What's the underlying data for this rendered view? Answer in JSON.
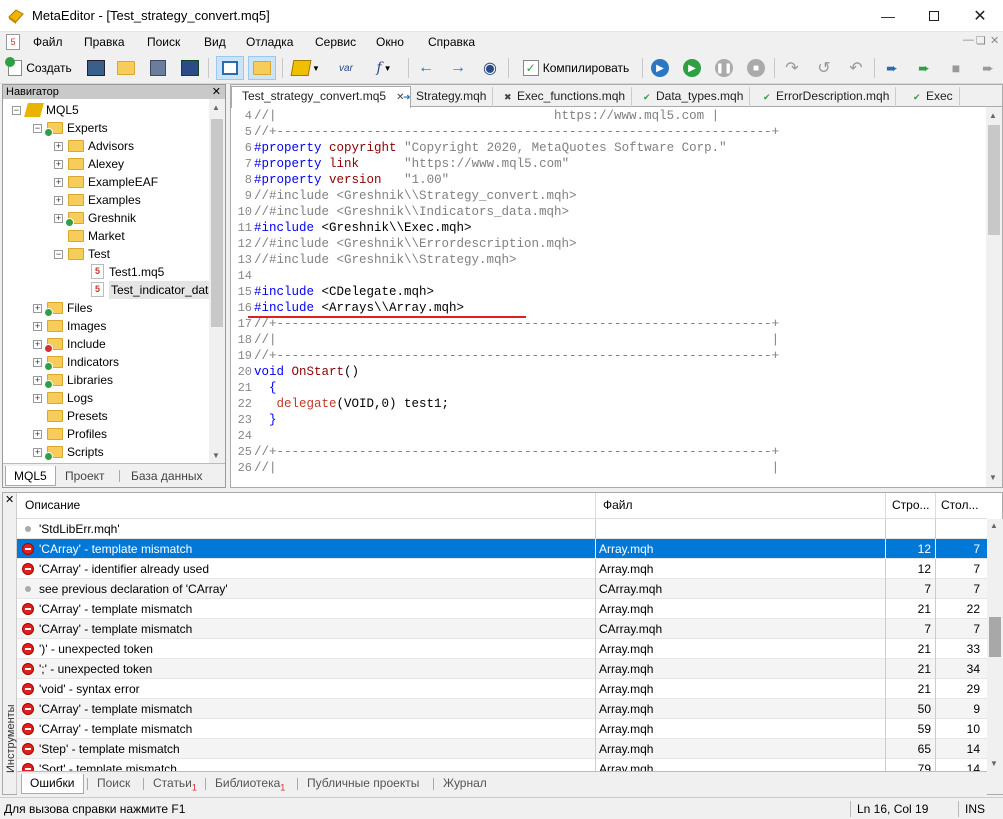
{
  "window": {
    "title": "MetaEditor - [Test_strategy_convert.mq5]"
  },
  "menu": [
    "Файл",
    "Правка",
    "Поиск",
    "Вид",
    "Отладка",
    "Сервис",
    "Окно",
    "Справка"
  ],
  "toolbar": {
    "create_label": "Создать",
    "compile_label": "Компилировать",
    "var_label": "var"
  },
  "navigator": {
    "title": "Навигатор",
    "items": [
      {
        "label": "MQL5"
      },
      {
        "label": "Experts"
      },
      {
        "label": "Advisors"
      },
      {
        "label": "Alexey"
      },
      {
        "label": "ExampleEAF"
      },
      {
        "label": "Examples"
      },
      {
        "label": "Greshnik"
      },
      {
        "label": "Market"
      },
      {
        "label": "Test"
      },
      {
        "label": "Test1.mq5"
      },
      {
        "label": "Test_indicator_data.m"
      },
      {
        "label": "Files"
      },
      {
        "label": "Images"
      },
      {
        "label": "Include"
      },
      {
        "label": "Indicators"
      },
      {
        "label": "Libraries"
      },
      {
        "label": "Logs"
      },
      {
        "label": "Presets"
      },
      {
        "label": "Profiles"
      },
      {
        "label": "Scripts"
      }
    ],
    "tabs": [
      "MQL5",
      "Проект",
      "База данных"
    ]
  },
  "editor": {
    "tabs": [
      "Test_strategy_convert.mq5",
      "Strategy.mqh",
      "Exec_functions.mqh",
      "Data_types.mqh",
      "ErrorDescription.mqh",
      "Exec"
    ],
    "lines": [
      {
        "n": "4",
        "t": "//|                                     https://www.mql5.com |",
        "c": "cm"
      },
      {
        "n": "5",
        "t": "//+------------------------------------------------------------------+",
        "c": "cm"
      },
      {
        "n": "6",
        "t": "#property copyright \"Copyright 2020, MetaQuotes Software Corp.\"",
        "c": "prop"
      },
      {
        "n": "7",
        "t": "#property link      \"https://www.mql5.com\"",
        "c": "prop"
      },
      {
        "n": "8",
        "t": "#property version   \"1.00\"",
        "c": "prop"
      },
      {
        "n": "9",
        "t": "//#include <Greshnik\\\\Strategy_convert.mqh>",
        "c": "cm"
      },
      {
        "n": "10",
        "t": "//#include <Greshnik\\\\Indicators_data.mqh>",
        "c": "cm"
      },
      {
        "n": "11",
        "t": "#include <Greshnik\\\\Exec.mqh>",
        "c": "inc"
      },
      {
        "n": "12",
        "t": "//#include <Greshnik\\\\Errordescription.mqh>",
        "c": "cm"
      },
      {
        "n": "13",
        "t": "//#include <Greshnik\\\\Strategy.mqh>",
        "c": "cm"
      },
      {
        "n": "14",
        "t": "",
        "c": ""
      },
      {
        "n": "15",
        "t": "#include <CDelegate.mqh>",
        "c": "inc"
      },
      {
        "n": "16",
        "t": "#include <Arrays\\\\Array.mqh>",
        "c": "inc"
      },
      {
        "n": "17",
        "t": "//+------------------------------------------------------------------+",
        "c": "cm"
      },
      {
        "n": "18",
        "t": "//|                                                                  |",
        "c": "cm"
      },
      {
        "n": "19",
        "t": "//+------------------------------------------------------------------+",
        "c": "cm"
      },
      {
        "n": "20",
        "t": "void OnStart()",
        "c": "fn"
      },
      {
        "n": "21",
        "t": "  {",
        "c": "br"
      },
      {
        "n": "22",
        "t": "   delegate(VOID,0) test1;",
        "c": "dl"
      },
      {
        "n": "23",
        "t": "  }",
        "c": "br"
      },
      {
        "n": "24",
        "t": "",
        "c": ""
      },
      {
        "n": "25",
        "t": "//+------------------------------------------------------------------+",
        "c": "cm"
      },
      {
        "n": "26",
        "t": "//|                                                                  |",
        "c": "cm"
      }
    ]
  },
  "tools": {
    "side_label": "Инструменты",
    "headers": {
      "desc": "Описание",
      "file": "Файл",
      "line": "Стро...",
      "col": "Стол..."
    },
    "rows": [
      {
        "type": "info",
        "desc": "'StdLibErr.mqh'",
        "file": "",
        "line": "",
        "col": ""
      },
      {
        "type": "error",
        "desc": "'CArray' - template mismatch",
        "file": "Array.mqh",
        "line": "12",
        "col": "7"
      },
      {
        "type": "error",
        "desc": "'CArray' - identifier already used",
        "file": "Array.mqh",
        "line": "12",
        "col": "7"
      },
      {
        "type": "info",
        "desc": "   see previous declaration of 'CArray'",
        "file": "CArray.mqh",
        "line": "7",
        "col": "7"
      },
      {
        "type": "error",
        "desc": "'CArray' - template mismatch",
        "file": "Array.mqh",
        "line": "21",
        "col": "22"
      },
      {
        "type": "error",
        "desc": "'CArray' - template mismatch",
        "file": "CArray.mqh",
        "line": "7",
        "col": "7"
      },
      {
        "type": "error",
        "desc": "')' - unexpected token",
        "file": "Array.mqh",
        "line": "21",
        "col": "33"
      },
      {
        "type": "error",
        "desc": "';' - unexpected token",
        "file": "Array.mqh",
        "line": "21",
        "col": "34"
      },
      {
        "type": "error",
        "desc": "'void' - syntax error",
        "file": "Array.mqh",
        "line": "21",
        "col": "29"
      },
      {
        "type": "error",
        "desc": "'CArray' - template mismatch",
        "file": "Array.mqh",
        "line": "50",
        "col": "9"
      },
      {
        "type": "error",
        "desc": "'CArray' - template mismatch",
        "file": "Array.mqh",
        "line": "59",
        "col": "10"
      },
      {
        "type": "error",
        "desc": "'Step' - template mismatch",
        "file": "Array.mqh",
        "line": "65",
        "col": "14"
      },
      {
        "type": "error",
        "desc": "'Sort' - template mismatch",
        "file": "Array.mqh",
        "line": "79",
        "col": "14"
      }
    ],
    "tabs": [
      {
        "label": "Ошибки",
        "badge": ""
      },
      {
        "label": "Поиск",
        "badge": ""
      },
      {
        "label": "Статьи",
        "badge": "1"
      },
      {
        "label": "Библиотека",
        "badge": "1"
      },
      {
        "label": "Публичные проекты",
        "badge": ""
      },
      {
        "label": "Журнал",
        "badge": ""
      }
    ]
  },
  "status": {
    "hint": "Для вызова справки нажмите F1",
    "position": "Ln 16, Col 19",
    "mode": "INS"
  },
  "colors": {
    "accent": "#0078d7",
    "error": "#e0201e",
    "keyword": "#0000ff",
    "preprocessor": "#8b0000"
  }
}
